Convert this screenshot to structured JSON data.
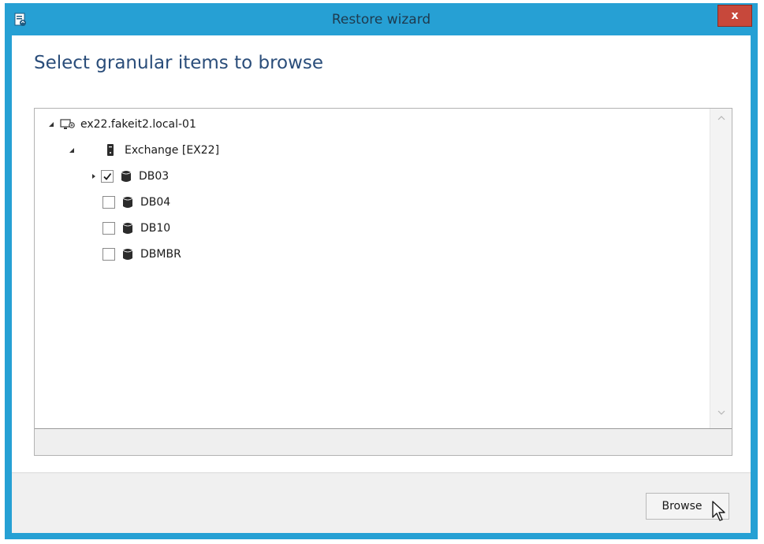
{
  "window": {
    "title": "Restore wizard",
    "close_label": "x",
    "accent_color": "#26a0d4"
  },
  "main": {
    "heading": "Select granular items to browse"
  },
  "tree": {
    "root": {
      "label": "ex22.fakeit2.local-01",
      "icon": "server-computer-icon",
      "expanded": true
    },
    "app": {
      "label": "Exchange [EX22]",
      "icon": "exchange-server-icon",
      "expanded": true
    },
    "databases": [
      {
        "label": "DB03",
        "checked": true,
        "has_children": true,
        "icon": "database-icon"
      },
      {
        "label": "DB04",
        "checked": false,
        "has_children": false,
        "icon": "database-icon"
      },
      {
        "label": "DB10",
        "checked": false,
        "has_children": false,
        "icon": "database-icon"
      },
      {
        "label": "DBMBR",
        "checked": false,
        "has_children": false,
        "icon": "database-icon"
      }
    ]
  },
  "footer": {
    "browse_label": "Browse"
  }
}
